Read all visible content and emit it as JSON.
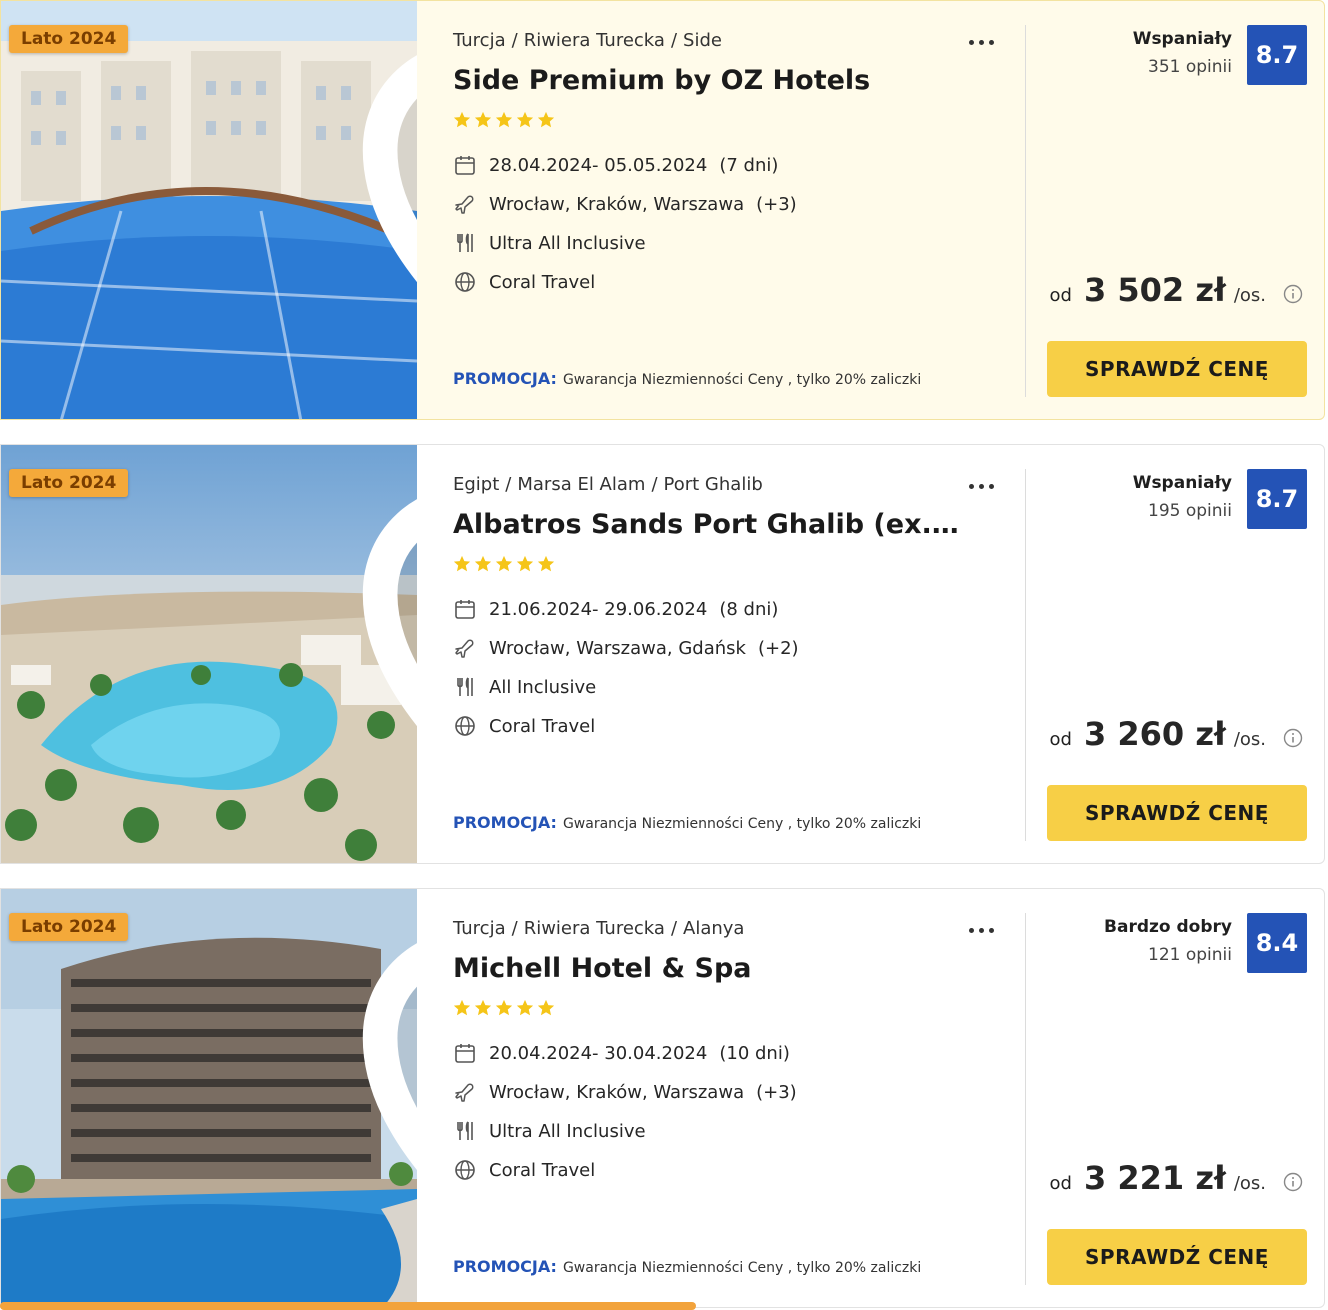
{
  "labels": {
    "promo": "PROMOCJA:",
    "from": "od",
    "per_person": "/os.",
    "cta": "SPRAWDŹ CENĘ"
  },
  "colors": {
    "accent_blue": "#2453b6",
    "cta_yellow": "#f7cf46",
    "badge_orange": "#f4a93a",
    "star": "#f5c518",
    "highlight_bg": "#fffbea"
  },
  "offers": [
    {
      "season": "Lato 2024",
      "country": "Turcja",
      "region": "Riwiera Turecka",
      "city": "Side",
      "name": "Side Premium by OZ Hotels",
      "stars": 5,
      "dates": "28.04.2024- 05.05.2024",
      "duration": "(7 dni)",
      "airports": "Wrocław, Kraków, Warszawa",
      "airports_more": "(+3)",
      "board": "Ultra All Inclusive",
      "operator": "Coral Travel",
      "promo_text": "Gwarancja Niezmienności Ceny , tylko 20% zaliczki",
      "rating_label": "Wspaniały",
      "reviews": "351 opinii",
      "score": "8.7",
      "price": "3 502 zł",
      "highlighted": true
    },
    {
      "season": "Lato 2024",
      "country": "Egipt",
      "region": "Marsa El Alam",
      "city": "Port Ghalib",
      "name": "Albatros Sands Port Ghalib (ex. Red ...",
      "stars": 5,
      "dates": "21.06.2024- 29.06.2024",
      "duration": "(8 dni)",
      "airports": "Wrocław, Warszawa, Gdańsk",
      "airports_more": "(+2)",
      "board": "All Inclusive",
      "operator": "Coral Travel",
      "promo_text": "Gwarancja Niezmienności Ceny , tylko 20% zaliczki",
      "rating_label": "Wspaniały",
      "reviews": "195 opinii",
      "score": "8.7",
      "price": "3 260 zł",
      "highlighted": false
    },
    {
      "season": "Lato 2024",
      "country": "Turcja",
      "region": "Riwiera Turecka",
      "city": "Alanya",
      "name": "Michell Hotel & Spa",
      "stars": 5,
      "dates": "20.04.2024- 30.04.2024",
      "duration": "(10 dni)",
      "airports": "Wrocław, Kraków, Warszawa",
      "airports_more": "(+3)",
      "board": "Ultra All Inclusive",
      "operator": "Coral Travel",
      "promo_text": "Gwarancja Niezmienności Ceny , tylko 20% zaliczki",
      "rating_label": "Bardzo dobry",
      "reviews": "121 opinii",
      "score": "8.4",
      "price": "3 221 zł",
      "highlighted": false
    }
  ]
}
